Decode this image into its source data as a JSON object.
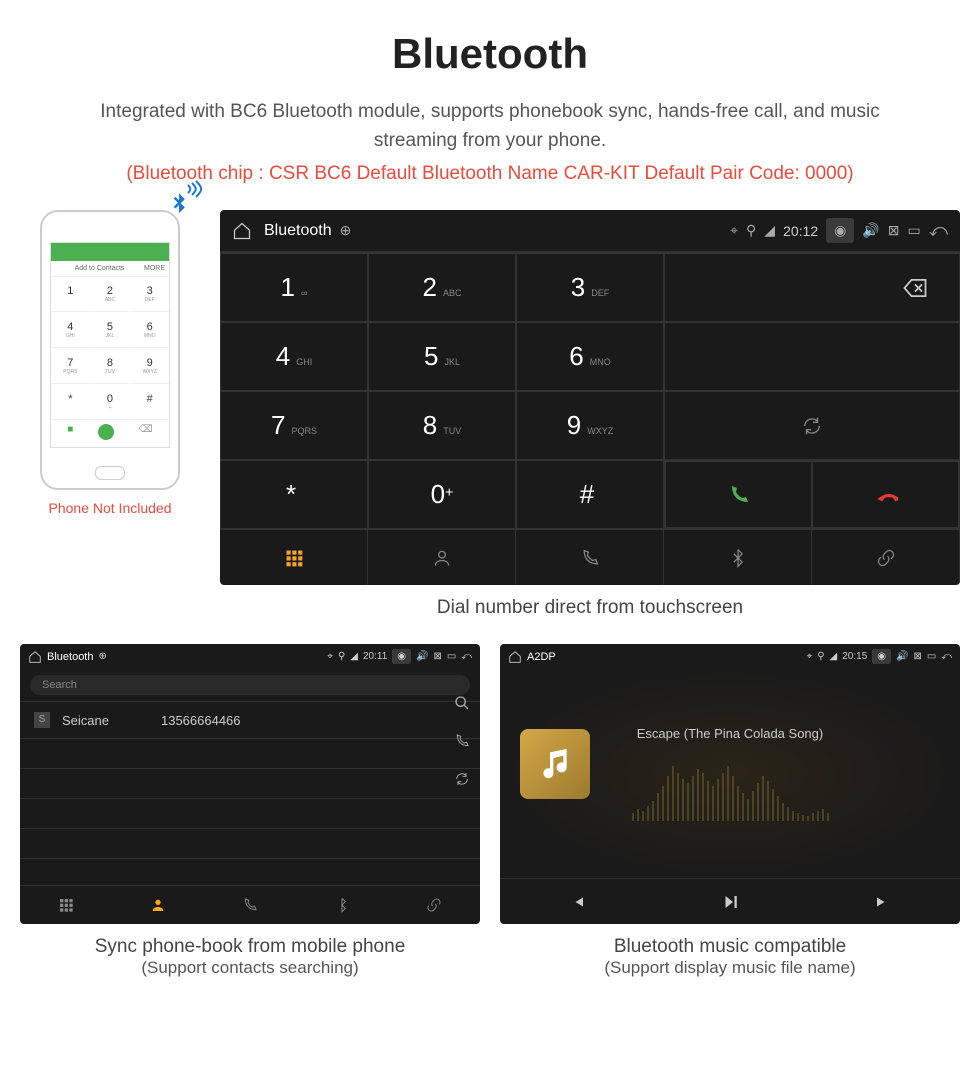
{
  "header": {
    "title": "Bluetooth",
    "subtitle": "Integrated with BC6 Bluetooth module, supports phonebook sync, hands-free call, and music streaming from your phone.",
    "specs": "(Bluetooth chip : CSR BC6     Default Bluetooth Name CAR-KIT     Default Pair Code: 0000)"
  },
  "phone_mock": {
    "note": "Phone Not Included",
    "contacts_label": "Add to Contacts",
    "more_label": "MORE",
    "keys": [
      {
        "n": "1",
        "s": ""
      },
      {
        "n": "2",
        "s": "ABC"
      },
      {
        "n": "3",
        "s": "DEF"
      },
      {
        "n": "4",
        "s": "GHI"
      },
      {
        "n": "5",
        "s": "JKL"
      },
      {
        "n": "6",
        "s": "MNO"
      },
      {
        "n": "7",
        "s": "PQRS"
      },
      {
        "n": "8",
        "s": "TUV"
      },
      {
        "n": "9",
        "s": "WXYZ"
      },
      {
        "n": "*",
        "s": ""
      },
      {
        "n": "0",
        "s": "+"
      },
      {
        "n": "#",
        "s": ""
      }
    ]
  },
  "dialer": {
    "statusbar": {
      "title": "Bluetooth",
      "time": "20:12"
    },
    "keys": [
      {
        "n": "1",
        "s": "∞"
      },
      {
        "n": "2",
        "s": "ABC"
      },
      {
        "n": "3",
        "s": "DEF"
      },
      {
        "n": "4",
        "s": "GHI"
      },
      {
        "n": "5",
        "s": "JKL"
      },
      {
        "n": "6",
        "s": "MNO"
      },
      {
        "n": "7",
        "s": "PQRS"
      },
      {
        "n": "8",
        "s": "TUV"
      },
      {
        "n": "9",
        "s": "WXYZ"
      },
      {
        "n": "*",
        "s": ""
      },
      {
        "n": "0",
        "s": "+"
      },
      {
        "n": "#",
        "s": ""
      }
    ],
    "caption": "Dial number direct from touchscreen"
  },
  "phonebook": {
    "statusbar": {
      "title": "Bluetooth",
      "time": "20:11"
    },
    "search_placeholder": "Search",
    "contacts": [
      {
        "letter": "S",
        "name": "Seicane",
        "number": "13566664466"
      }
    ],
    "caption": "Sync phone-book from mobile phone",
    "caption_sub": "(Support contacts searching)"
  },
  "music": {
    "statusbar": {
      "title": "A2DP",
      "time": "20:15"
    },
    "song": "Escape (The Pina Colada Song)",
    "caption": "Bluetooth music compatible",
    "caption_sub": "(Support display music file name)"
  }
}
